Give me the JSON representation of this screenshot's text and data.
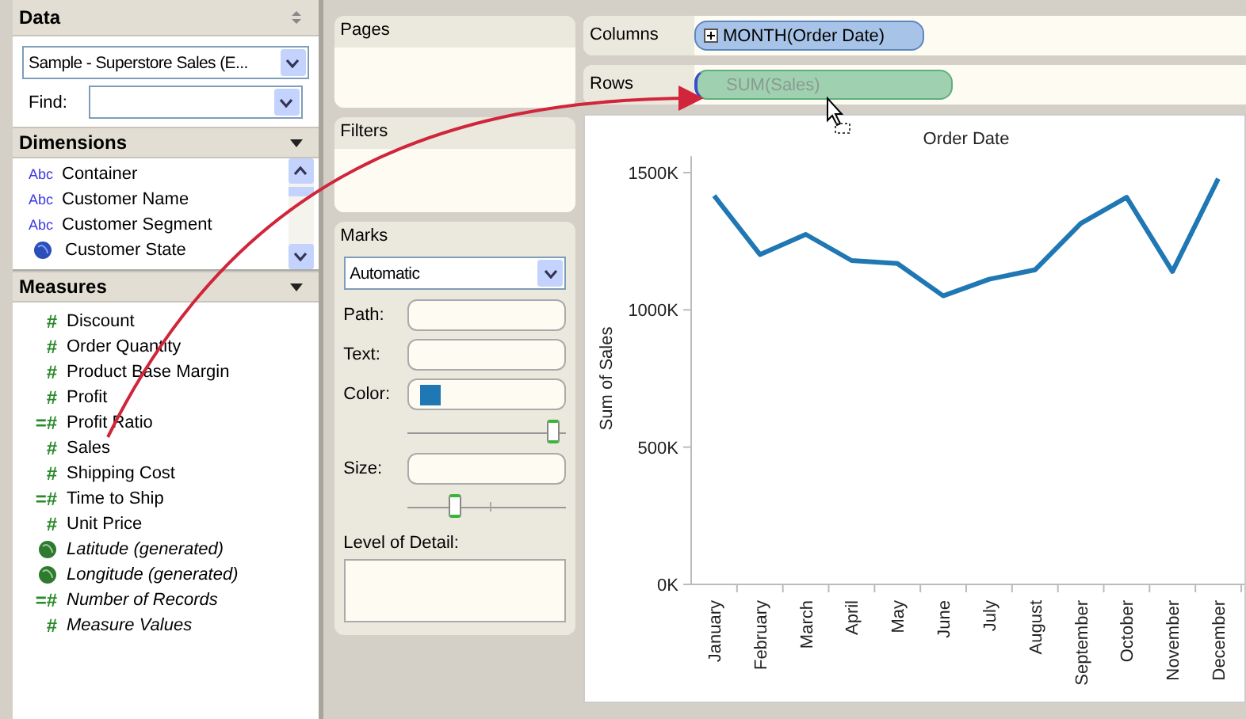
{
  "data_pane": {
    "title": "Data",
    "source": "Sample - Superstore Sales (E...",
    "find_label": "Find:"
  },
  "dimensions": {
    "title": "Dimensions",
    "items": [
      {
        "kind": "string",
        "type_icon": "Abc",
        "label": "Container"
      },
      {
        "kind": "string",
        "type_icon": "Abc",
        "label": "Customer Name"
      },
      {
        "kind": "string",
        "type_icon": "Abc",
        "label": "Customer Segment"
      },
      {
        "kind": "geo",
        "label": "Customer State"
      }
    ]
  },
  "measures": {
    "title": "Measures",
    "items": [
      {
        "kind": "measure",
        "type_icon": "#",
        "label": "Discount",
        "italic": false
      },
      {
        "kind": "measure",
        "type_icon": "#",
        "label": "Order Quantity",
        "italic": false
      },
      {
        "kind": "measure",
        "type_icon": "#",
        "label": "Product Base Margin",
        "italic": false
      },
      {
        "kind": "measure",
        "type_icon": "#",
        "label": "Profit",
        "italic": false
      },
      {
        "kind": "calculated",
        "type_icon": "=#",
        "label": "Profit Ratio",
        "italic": false
      },
      {
        "kind": "measure",
        "type_icon": "#",
        "label": "Sales",
        "italic": false
      },
      {
        "kind": "measure",
        "type_icon": "#",
        "label": "Shipping Cost",
        "italic": false
      },
      {
        "kind": "calculated",
        "type_icon": "=#",
        "label": "Time to Ship",
        "italic": false
      },
      {
        "kind": "measure",
        "type_icon": "#",
        "label": "Unit Price",
        "italic": false
      },
      {
        "kind": "geo",
        "label": "Latitude (generated)",
        "italic": true
      },
      {
        "kind": "geo",
        "label": "Longitude (generated)",
        "italic": true
      },
      {
        "kind": "calculated",
        "type_icon": "=#",
        "label": "Number of Records",
        "italic": true
      },
      {
        "kind": "measure",
        "type_icon": "#",
        "label": "Measure Values",
        "italic": true
      }
    ]
  },
  "pages": {
    "title": "Pages"
  },
  "filters": {
    "title": "Filters"
  },
  "marks": {
    "title": "Marks",
    "type": "Automatic",
    "path_label": "Path:",
    "text_label": "Text:",
    "color_label": "Color:",
    "color": "#1f77b4",
    "color_slider": {
      "level": 1.0
    },
    "size_label": "Size:",
    "size_slider": {
      "level": 0.3
    },
    "detail_label": "Level of Detail:"
  },
  "columns_shelf": {
    "label": "Columns",
    "pill": {
      "text": "MONTH(Order Date)",
      "kind": "dimension",
      "ghost": false
    }
  },
  "rows_shelf": {
    "label": "Rows",
    "pill": {
      "text": "SUM(Sales)",
      "kind": "measure",
      "ghost": true
    }
  },
  "chart": {
    "chart_data": {
      "type": "line",
      "title": "Order Date",
      "ylabel": "Sum of Sales",
      "categories": [
        "January",
        "February",
        "March",
        "April",
        "May",
        "June",
        "July",
        "August",
        "September",
        "October",
        "November",
        "December"
      ],
      "series": [
        {
          "color": "#1f77b4",
          "values": [
            1416,
            1202,
            1275,
            1180,
            1169,
            1051,
            1112,
            1146,
            1315,
            1410,
            1140,
            1478
          ]
        }
      ],
      "ylim": [
        0,
        1560
      ],
      "yticks": [
        {
          "value": 0,
          "label": "0K"
        },
        {
          "value": 500,
          "label": "500K"
        },
        {
          "value": 1000,
          "label": "1000K"
        },
        {
          "value": 1500,
          "label": "1500K"
        }
      ]
    }
  }
}
